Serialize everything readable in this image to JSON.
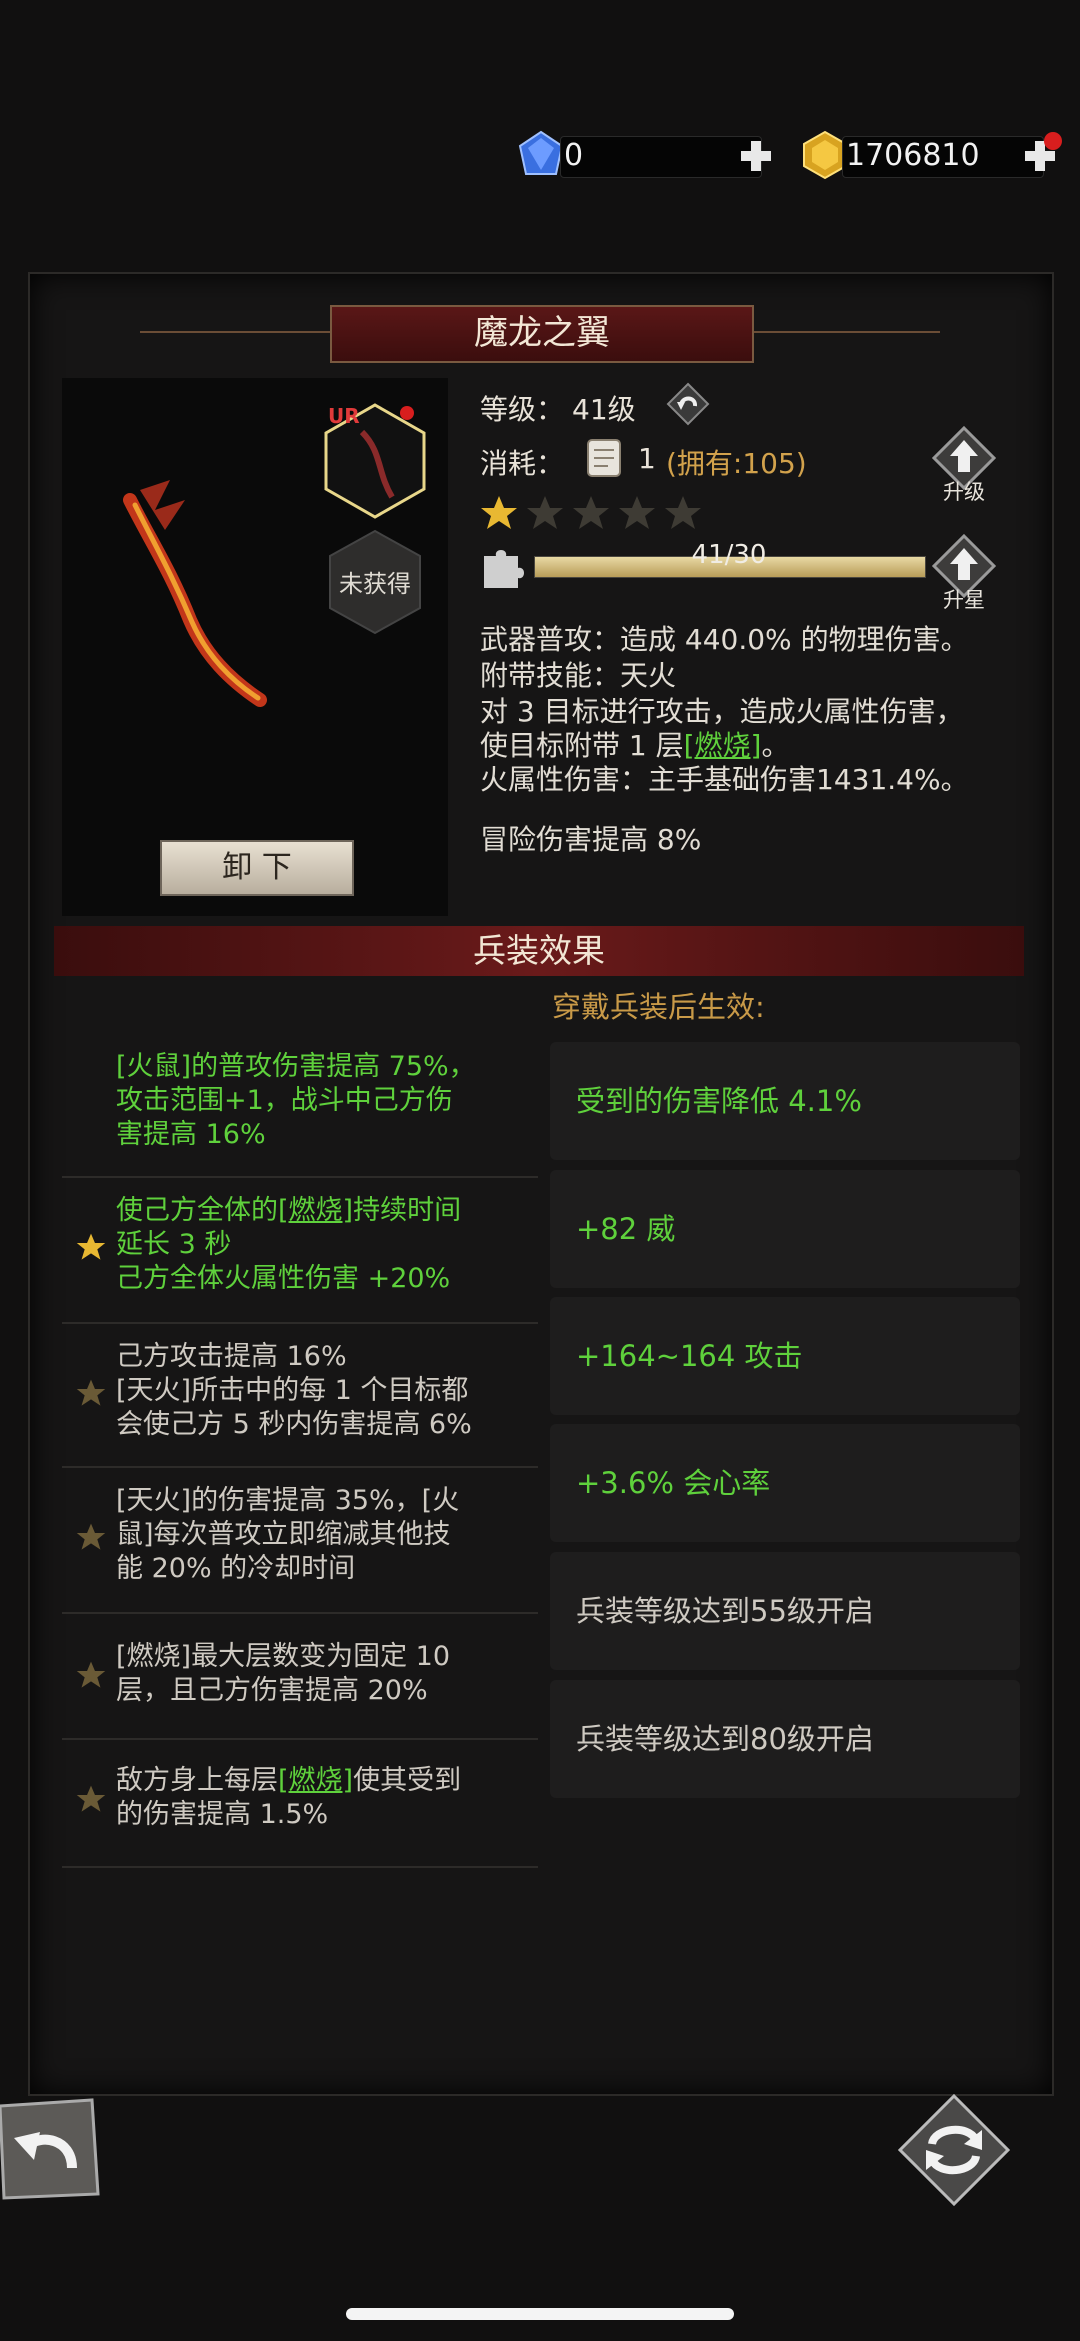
{
  "currency": {
    "gems": "0",
    "gold": "1706810"
  },
  "title": "魔龙之翼",
  "weapon": {
    "rarity": "UR",
    "status": "未获得",
    "unequip_label": "卸 下"
  },
  "stats": {
    "level_label": "等级：",
    "level_value": "41级",
    "cost_label": "消耗：",
    "cost_amount": "1",
    "cost_owned": "(拥有:105)",
    "upgrade_label": "升级",
    "star_up_label": "升星",
    "stars_filled": 1,
    "stars_total": 5,
    "progress_text": "41/30",
    "progress_fill": 1.0
  },
  "description": {
    "line1": "武器普攻：造成 440.0% 的物理伤害。",
    "line2": "附带技能：天火",
    "line3": "对 3 目标进行攻击，造成火属性伤害，",
    "line4_pre": "使目标附带 1 层",
    "line4_kw": "[燃烧]",
    "line4_post": "。",
    "line5": "火属性伤害：主手基础伤害1431.4%。",
    "line6": "冒险伤害提高 8%"
  },
  "section": {
    "title": "兵装效果",
    "wear_hint": "穿戴兵装后生效:"
  },
  "effects": [
    {
      "line1": "[火鼠]的普攻伤害提高 75%，",
      "line2": "攻击范围+1，战斗中己方伤",
      "line3": "害提高 16%",
      "star": "none"
    },
    {
      "line1_pre": "使己方全体的",
      "line1_kw": "[燃烧]",
      "line1_post": "持续时间",
      "line2": "延长 3 秒",
      "line3": "己方全体火属性伤害 +20%",
      "star": "active"
    },
    {
      "line1": "己方攻击提高 16%",
      "line2": "[天火]所击中的每 1 个目标都",
      "line3": "会使己方 5 秒内伤害提高 6%",
      "star": "inactive"
    },
    {
      "line1": "[天火]的伤害提高 35%，[火",
      "line2": "鼠]每次普攻立即缩减其他技",
      "line3": "能 20% 的冷却时间",
      "star": "inactive"
    },
    {
      "line1": "[燃烧]最大层数变为固定 10",
      "line2": "层，且己方伤害提高 20%",
      "star": "inactive"
    },
    {
      "line1_pre": "敌方身上每层",
      "line1_kw": "[燃烧]",
      "line1_post": "使其受到",
      "line2": "的伤害提高 1.5%",
      "star": "inactive"
    }
  ],
  "bonuses": [
    {
      "text": "受到的伤害降低 4.1%",
      "color": "#5fd13c"
    },
    {
      "text": "+82 威",
      "color": "#5fd13c"
    },
    {
      "text": "+164~164 攻击",
      "color": "#5fd13c"
    },
    {
      "text": "+3.6% 会心率",
      "color": "#5fd13c"
    },
    {
      "text": "兵装等级达到55级开启",
      "color": "#cfcac2"
    },
    {
      "text": "兵装等级达到80级开启",
      "color": "#cfcac2"
    }
  ]
}
